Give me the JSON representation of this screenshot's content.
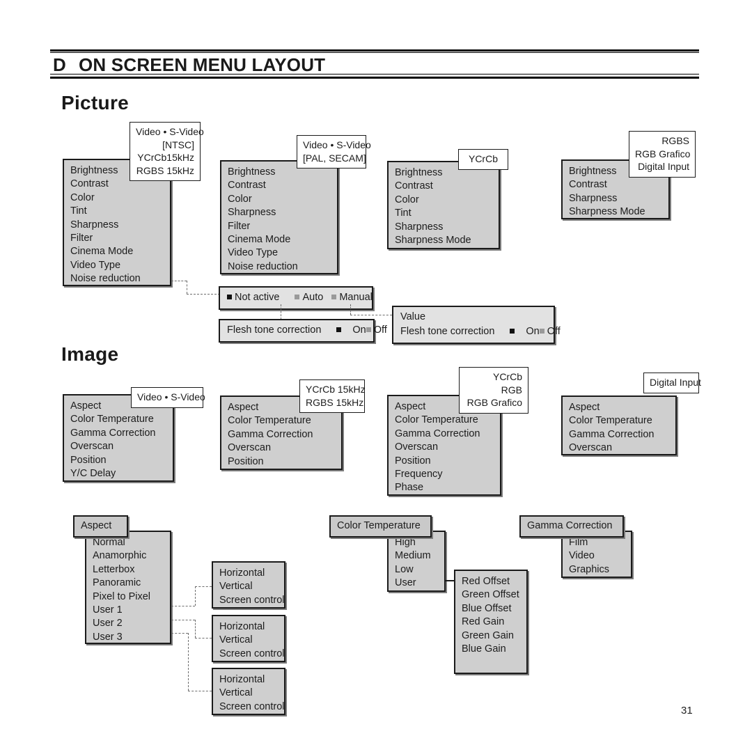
{
  "header": {
    "letter": "D",
    "title": "ON SCREEN MENU LAYOUT"
  },
  "page_number": "31",
  "sections": {
    "picture": {
      "title": "Picture"
    },
    "image": {
      "title": "Image"
    }
  },
  "picture": {
    "groups": [
      {
        "callout": "Video • S-Video\n[NTSC]\nYCrCb15kHz\nRGBS 15kHz",
        "callout_lines": [
          "Video • S-Video",
          "[NTSC]",
          "YCrCb15kHz",
          "RGBS 15kHz"
        ],
        "items": [
          "Brightness",
          "Contrast",
          "Color",
          "Tint",
          "Sharpness",
          "Filter",
          "Cinema Mode",
          "Video Type",
          "Noise reduction"
        ]
      },
      {
        "callout_lines": [
          "Video • S-Video",
          "[PAL, SECAM]"
        ],
        "items": [
          "Brightness",
          "Contrast",
          "Color",
          "Sharpness",
          "Filter",
          "Cinema Mode",
          "Video Type",
          "Noise reduction"
        ]
      },
      {
        "callout_lines": [
          "YCrCb"
        ],
        "items": [
          "Brightness",
          "Contrast",
          "Color",
          "Tint",
          "Sharpness",
          "Sharpness Mode"
        ]
      },
      {
        "callout_lines": [
          "RGBS",
          "RGB Grafico",
          "Digital Input"
        ],
        "items": [
          "Brightness",
          "Contrast",
          "Sharpness",
          "Sharpness Mode"
        ]
      }
    ],
    "noise_bar": {
      "options": [
        {
          "label": "Not active",
          "selected": true
        },
        {
          "label": "Auto",
          "selected": false
        },
        {
          "label": "Manual",
          "selected": false
        }
      ]
    },
    "flesh_bar_left": {
      "label": "Flesh tone correction",
      "options": [
        {
          "label": "On",
          "selected": true
        },
        {
          "label": "Off",
          "selected": false
        }
      ]
    },
    "flesh_bar_right": {
      "value_label": "Value",
      "label": "Flesh tone correction",
      "options": [
        {
          "label": "On",
          "selected": true
        },
        {
          "label": "Off",
          "selected": false
        }
      ]
    }
  },
  "image": {
    "groups": [
      {
        "callout_lines": [
          "Video • S-Video"
        ],
        "items": [
          "Aspect",
          "Color Temperature",
          "Gamma Correction",
          "Overscan",
          "Position",
          "Y/C  Delay"
        ]
      },
      {
        "callout_lines": [
          "YCrCb  15kHz",
          "RGBS  15kHz"
        ],
        "items": [
          "Aspect",
          "Color Temperature",
          "Gamma Correction",
          "Overscan",
          "Position"
        ]
      },
      {
        "callout_lines": [
          "YCrCb",
          "RGB",
          "RGB  Grafico"
        ],
        "items": [
          "Aspect",
          "Color Temperature",
          "Gamma Correction",
          "Overscan",
          "Position",
          "Frequency",
          "Phase"
        ]
      },
      {
        "callout_lines": [
          "Digital Input"
        ],
        "items": [
          "Aspect",
          "Color Temperature",
          "Gamma Correction",
          "Overscan"
        ]
      }
    ],
    "submenus": {
      "aspect": {
        "title": "Aspect",
        "items": [
          "Normal",
          "Anamorphic",
          "Letterbox",
          "Panoramic",
          "Pixel to Pixel",
          "User 1",
          "User 2",
          "User 3"
        ]
      },
      "user_boxes": [
        {
          "items": [
            "Horizontal",
            "Vertical",
            "Screen control"
          ]
        },
        {
          "items": [
            "Horizontal",
            "Vertical",
            "Screen control"
          ]
        },
        {
          "items": [
            "Horizontal",
            "Vertical",
            "Screen control"
          ]
        }
      ],
      "color_temperature": {
        "title": "Color Temperature",
        "items": [
          "High",
          "Medium",
          "Low",
          "User"
        ]
      },
      "user_gains": {
        "items": [
          "Red Offset",
          "Green Offset",
          "Blue Offset",
          "Red Gain",
          "Green Gain",
          "Blue Gain"
        ]
      },
      "gamma_correction": {
        "title": "Gamma Correction",
        "items": [
          "Film",
          "Video",
          "Graphics"
        ]
      }
    }
  },
  "colors": {
    "menu_fill": "#cfcfcf",
    "bar_fill": "#e2e2e2",
    "tab_fill": "#c9c9c9",
    "border": "#1a1a1a",
    "shadow": "#7d7d7d",
    "dashed": "#6d6d6d"
  }
}
